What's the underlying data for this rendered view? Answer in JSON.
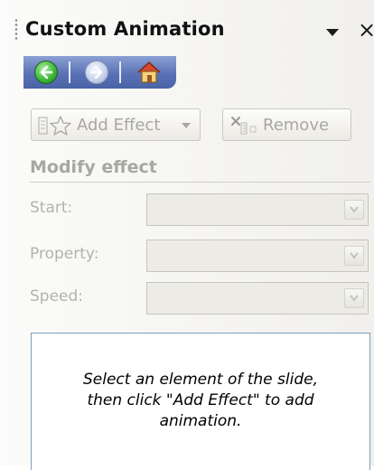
{
  "pane": {
    "title": "Custom Animation"
  },
  "navigation": {
    "back_icon": "back-arrow-icon",
    "forward_icon": "forward-arrow-icon",
    "home_icon": "home-icon"
  },
  "toolbar": {
    "add_effect_label": "Add Effect",
    "remove_label": "Remove"
  },
  "modify_effect": {
    "heading": "Modify effect",
    "fields": [
      {
        "label": "Start:",
        "value": ""
      },
      {
        "label": "Property:",
        "value": ""
      },
      {
        "label": "Speed:",
        "value": ""
      }
    ]
  },
  "effect_list": {
    "hint_line1": "Select an element of the slide,",
    "hint_line2": "then click \"Add Effect\" to add",
    "hint_line3": "animation."
  },
  "colors": {
    "nav_strip": "#5a72b5",
    "disabled_text": "#a8a7a0",
    "list_border": "#7f9db9"
  }
}
